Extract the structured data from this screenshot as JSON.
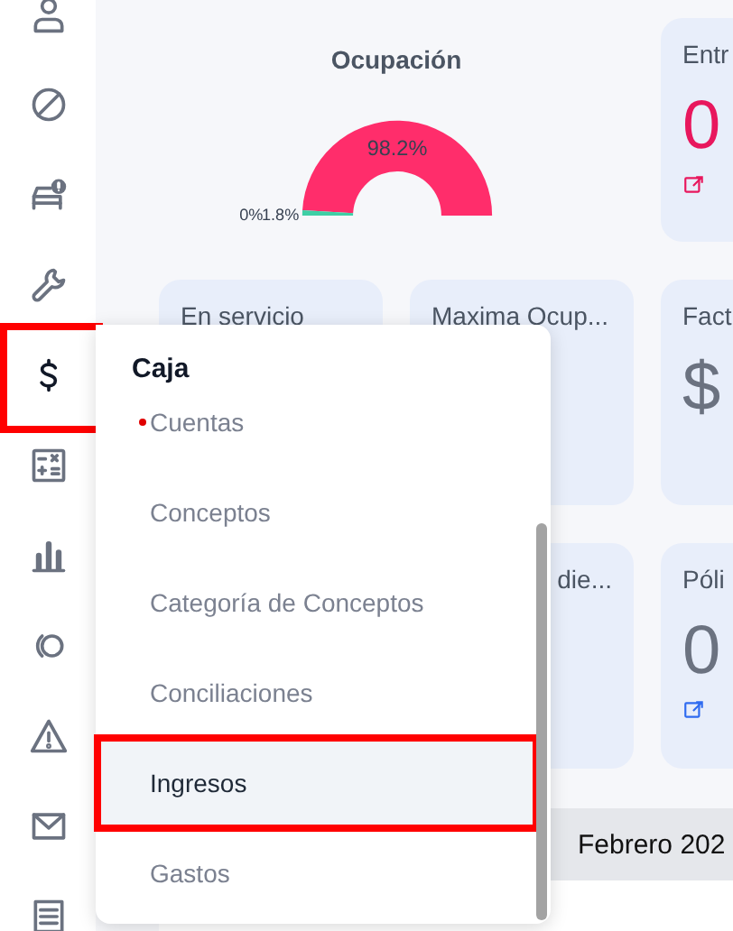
{
  "sidebar": {
    "items": [
      {
        "highlighted": false
      },
      {
        "highlighted": false
      },
      {
        "highlighted": false
      },
      {
        "highlighted": false
      },
      {
        "highlighted": true
      },
      {
        "highlighted": false
      },
      {
        "highlighted": false
      },
      {
        "highlighted": false
      },
      {
        "highlighted": false
      },
      {
        "highlighted": false
      },
      {
        "highlighted": false
      }
    ]
  },
  "occupancy": {
    "title": "Ocupación",
    "chart_data": {
      "type": "donut",
      "values": [
        98.2,
        1.8,
        0
      ],
      "value_labels": [
        "98.2%",
        "1.8%",
        "0%"
      ]
    }
  },
  "cards": [
    {
      "title": "Entr",
      "kind": "alert",
      "value": "0",
      "color": "#e8175d"
    },
    {
      "title": "En servicio",
      "kind": "plain"
    },
    {
      "title": "Maxima Ocup...",
      "kind": "plain"
    },
    {
      "title": "Fact",
      "kind": "plain",
      "value": "$"
    },
    {
      "title": "die...",
      "kind": "covered"
    },
    {
      "title": "Póli",
      "kind": "plain",
      "value": "0",
      "color": "#2f6bf0"
    }
  ],
  "calendar": {
    "month": "Febrero 202"
  },
  "menu": {
    "title": "Caja",
    "items": [
      {
        "label": "Cuentas",
        "marked": true,
        "selected": false,
        "highlighted": false
      },
      {
        "label": "Conceptos",
        "marked": false,
        "selected": false,
        "highlighted": false
      },
      {
        "label": "Categoría de Conceptos",
        "marked": false,
        "selected": false,
        "highlighted": false
      },
      {
        "label": "Conciliaciones",
        "marked": false,
        "selected": false,
        "highlighted": false
      },
      {
        "label": "Ingresos",
        "marked": false,
        "selected": true,
        "highlighted": true
      },
      {
        "label": "Gastos",
        "marked": false,
        "selected": false,
        "highlighted": false
      }
    ]
  }
}
